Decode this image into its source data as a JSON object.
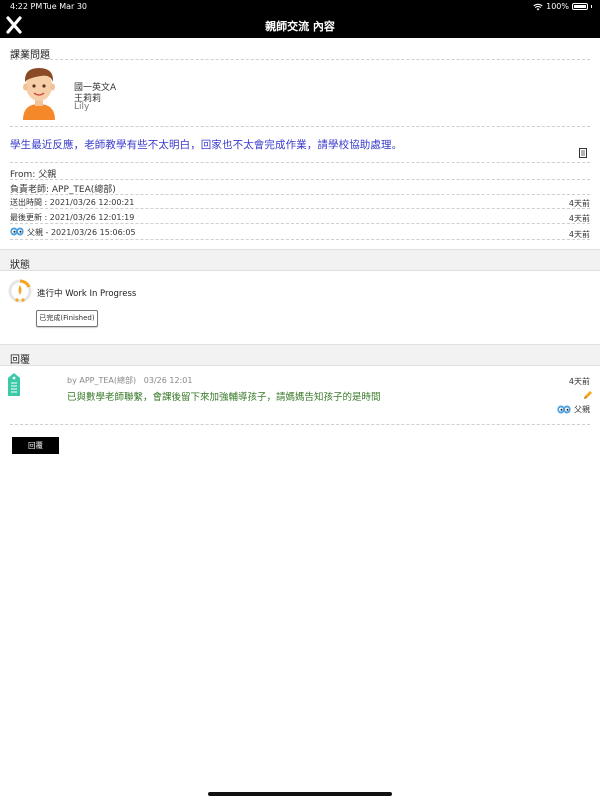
{
  "status_bar": {
    "time": "4:22 PM",
    "date": "Tue Mar 30",
    "battery": "100%"
  },
  "nav": {
    "title": "親師交流 內容"
  },
  "course": {
    "label": "課業問題"
  },
  "student": {
    "class": "國一英文A",
    "name": "王莉莉",
    "english_name": "Lily"
  },
  "message": "學生最近反應，老師教學有些不太明白，回家也不太會完成作業，請學校協助處理。",
  "from": "From: 父親",
  "teacher": "負責老師: APP_TEA(總部)",
  "sent": {
    "label": "送出時間 : 2021/03/26 12:00:21",
    "ago": "4天前"
  },
  "updated": {
    "label": "最後更新 : 2021/03/26 12:01:19",
    "ago": "4天前"
  },
  "viewed": {
    "label": "父親 - 2021/03/26 15:06:05",
    "ago": "4天前"
  },
  "status_section": {
    "title": "狀態",
    "state_zh": "進行中",
    "state_en": "Work In Progress",
    "finish_button": "已完成(Finished)"
  },
  "reply_section": {
    "title": "回覆",
    "meta_by": "by APP_TEA(總部)",
    "meta_time": "03/26 12:01",
    "text": "已與數學老師聯繫，會課後留下來加強輔導孩子，請媽媽告知孩子的是時間",
    "ago": "4天前",
    "seen_by": "父親",
    "reply_button": "回覆"
  },
  "colors": {
    "message": "#3a3acc",
    "reply": "#3a7a2a",
    "accent": "#f5a623",
    "tag": "#3cc9a8"
  },
  "icons": [
    "close-icon",
    "student-avatar",
    "document-icon",
    "eyes-icon",
    "status-progress-icon",
    "tag-icon",
    "pencil-icon"
  ]
}
